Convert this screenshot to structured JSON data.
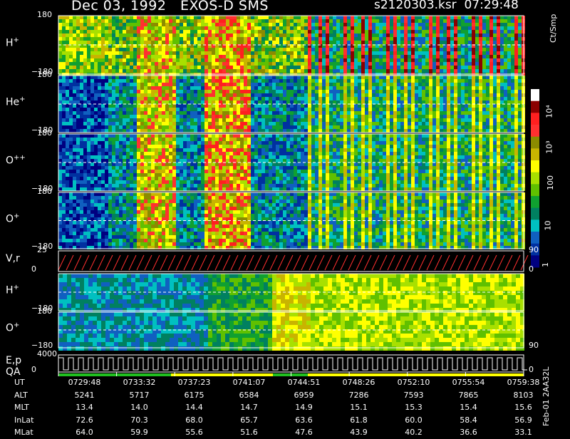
{
  "header": {
    "title": "Dec 03, 1992   EXOS-D SMS",
    "file": "s2120303.ksr  07:29:48"
  },
  "panels": [
    {
      "label": "H",
      "sup": "+",
      "ymax": "180",
      "ymin": "−180"
    },
    {
      "label": "He",
      "sup": "+",
      "ymax": "180",
      "ymin": "−180"
    },
    {
      "label": "O",
      "sup": "++",
      "ymax": "180",
      "ymin": "−180"
    },
    {
      "label": "O",
      "sup": "+",
      "ymax": "180",
      "ymin": "−180"
    },
    {
      "label": "V,r",
      "sup": "",
      "ymax": "25",
      "ymin": "0",
      "right_max": "90",
      "right_min": "0"
    },
    {
      "label": "H",
      "sup": "+",
      "ymax": "",
      "ymin": "−180"
    },
    {
      "label": "O",
      "sup": "+",
      "ymax": "180",
      "ymin": "−180",
      "right_min": "90"
    },
    {
      "label": "E,p",
      "sup": "",
      "label2": "QA",
      "ymax": "4000",
      "ymin": "0",
      "right_min": "0"
    }
  ],
  "colorbar": {
    "unit": "Ct/Smp",
    "tick_labels": [
      "10⁴",
      "10³",
      "100",
      "10",
      "1"
    ],
    "colors": [
      "#ffffff",
      "#8b0000",
      "#ff2020",
      "#ff3030",
      "#8b8b00",
      "#c8b400",
      "#ffff00",
      "#a8e000",
      "#60c000",
      "#10a030",
      "#008060",
      "#00c0c0",
      "#1060c0",
      "#0030a0",
      "#000080"
    ]
  },
  "chart_data": {
    "type": "heatmap",
    "title": "Dec 03, 1992   EXOS-D SMS",
    "xlabel": "UT",
    "x_ticks": [
      "0729:48",
      "0733:32",
      "0737:23",
      "0741:07",
      "0744:51",
      "0748:26",
      "0752:10",
      "0755:54",
      "0759:38"
    ],
    "ephemeris": [
      {
        "name": "UT",
        "values": [
          "0729:48",
          "0733:32",
          "0737:23",
          "0741:07",
          "0744:51",
          "0748:26",
          "0752:10",
          "0755:54",
          "0759:38"
        ]
      },
      {
        "name": "ALT",
        "values": [
          "5241",
          "5717",
          "6175",
          "6584",
          "6959",
          "7286",
          "7593",
          "7865",
          "8103"
        ]
      },
      {
        "name": "MLT",
        "values": [
          "13.4",
          "14.0",
          "14.4",
          "14.7",
          "14.9",
          "15.1",
          "15.3",
          "15.4",
          "15.6"
        ]
      },
      {
        "name": "InLat",
        "values": [
          "72.6",
          "70.3",
          "68.0",
          "65.7",
          "63.6",
          "61.8",
          "60.0",
          "58.4",
          "56.9"
        ]
      },
      {
        "name": "MLat",
        "values": [
          "64.0",
          "59.9",
          "55.6",
          "51.6",
          "47.6",
          "43.9",
          "40.2",
          "36.6",
          "33.1"
        ]
      }
    ]
  },
  "footer": {
    "side_id": "Feb-01 2AA32L"
  }
}
